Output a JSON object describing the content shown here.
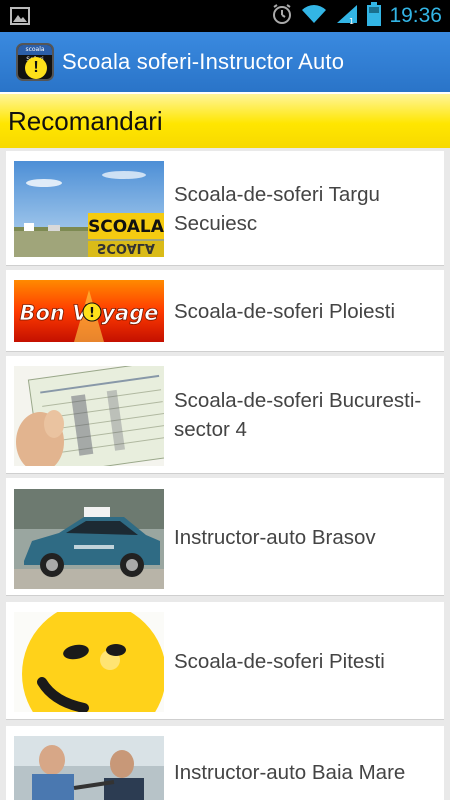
{
  "status_bar": {
    "time": "19:36"
  },
  "action_bar": {
    "title": "Scoala soferi-Instructor Auto",
    "icon_caption": "scoala Soferi"
  },
  "section": {
    "title": "Recomandari"
  },
  "items": [
    {
      "label": "Scoala-de-soferi Targu Secuiesc",
      "thumb_text": "SCOALA"
    },
    {
      "label": "Scoala-de-soferi Ploiesti",
      "thumb_text": "Bon Voyage"
    },
    {
      "label": "Scoala-de-soferi Bucuresti-sector 4"
    },
    {
      "label": "Instructor-auto Brasov"
    },
    {
      "label": "Scoala-de-soferi Pitesti"
    },
    {
      "label": "Instructor-auto Baia Mare"
    }
  ]
}
